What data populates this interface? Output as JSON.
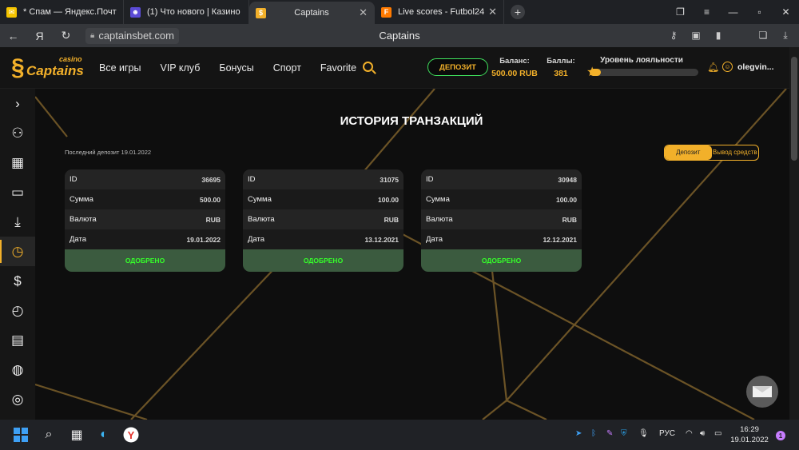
{
  "browser": {
    "tabs": [
      {
        "label": "* Спам — Яндекс.Почта",
        "favicon": "mail-icon",
        "color": "#f5c400"
      },
      {
        "label": "(1) Что нового | Казино ф",
        "favicon": "forum-icon",
        "color": "#5b4bd6"
      },
      {
        "label": "Captains",
        "favicon": "captains-favicon",
        "color": "#f2b02a"
      },
      {
        "label": "Live scores - Futbol24",
        "favicon": "futbol24-icon",
        "color": "#ff7a00"
      }
    ],
    "url": "captainsbet.com",
    "page_title": "Captains"
  },
  "site": {
    "logo": {
      "brand": "Captains",
      "tag": "casino"
    },
    "menu": [
      "Все игры",
      "VIP клуб",
      "Бонусы",
      "Спорт",
      "Favorite"
    ],
    "deposit_button": "ДЕПОЗИТ",
    "balance": {
      "label": "Баланс:",
      "value": "500.00 RUB"
    },
    "points": {
      "label": "Баллы:",
      "value": "381"
    },
    "loyalty": {
      "label": "Уровень лояльности",
      "progress": 0.1
    },
    "username": "olegvin..."
  },
  "sidebar": [
    "chevron-right-icon",
    "users-icon",
    "coins-icon",
    "wallet-icon",
    "download-icon",
    "history-icon",
    "money-bag-icon",
    "clock-dollar-icon",
    "id-card-icon",
    "globe-icon",
    "chat-icon"
  ],
  "page": {
    "title": "ИСТОРИЯ ТРАНЗАКЦИЙ",
    "last_deposit": "Последний депозит 19.01.2022",
    "toggle": {
      "deposit": "Депозит",
      "withdraw": "Вывод средств"
    },
    "labels": {
      "id": "ID",
      "amount": "Сумма",
      "currency": "Валюта",
      "date": "Дата"
    },
    "transactions": [
      {
        "id": "36695",
        "amount": "500.00",
        "currency": "RUB",
        "date": "19.01.2022",
        "status": "ОДОБРЕНО"
      },
      {
        "id": "31075",
        "amount": "100.00",
        "currency": "RUB",
        "date": "13.12.2021",
        "status": "ОДОБРЕНО"
      },
      {
        "id": "30948",
        "amount": "100.00",
        "currency": "RUB",
        "date": "12.12.2021",
        "status": "ОДОБРЕНО"
      }
    ]
  },
  "taskbar": {
    "lang": "РУС",
    "time": "16:29",
    "date": "19.01.2022",
    "notifications": "1"
  }
}
